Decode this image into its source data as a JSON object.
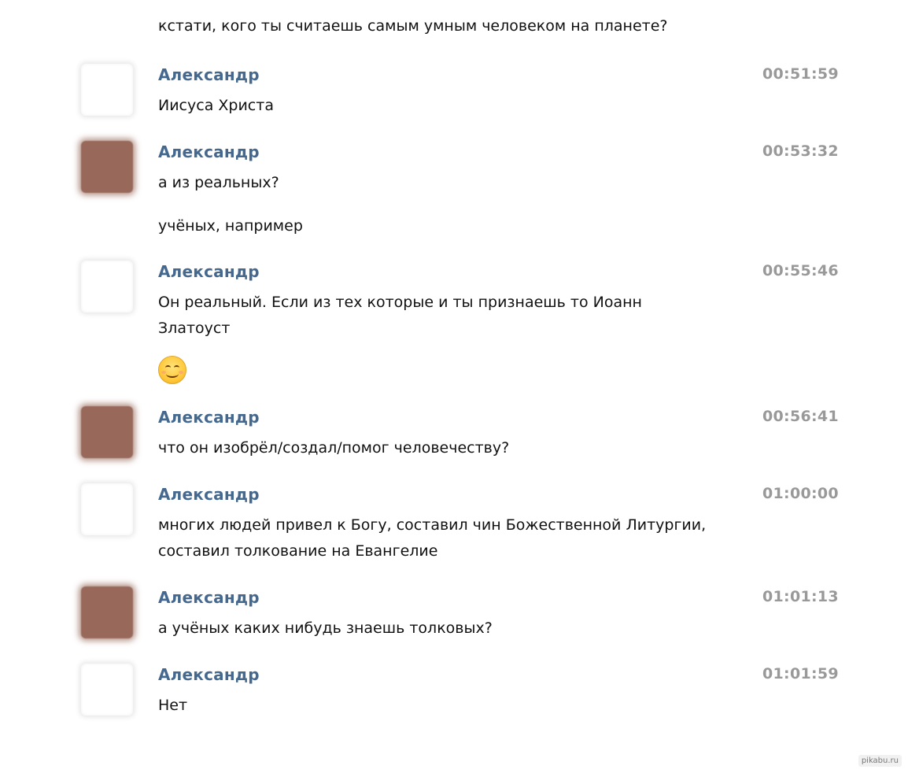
{
  "intro_text": "кстати, кого ты считаешь самым умным человеком на планете?",
  "messages": [
    {
      "author": "Александр",
      "time": "00:51:59",
      "lines": [
        "Иисуса Христа"
      ]
    },
    {
      "author": "Александр",
      "time": "00:53:32",
      "lines": [
        "а из реальных?",
        "учёных, например"
      ]
    },
    {
      "author": "Александр",
      "time": "00:55:46",
      "lines": [
        "Он реальный. Если из тех которые и ты признаешь то Иоанн",
        "Златоуст"
      ]
    },
    {
      "author": "Александр",
      "time": "00:56:41",
      "lines": [
        "что он изобрёл/создал/помог человечеству?"
      ]
    },
    {
      "author": "Александр",
      "time": "01:00:00",
      "lines": [
        "многих людей привел к Богу, составил чин Божественной Литургии,",
        "составил толкование на Евангелие"
      ]
    },
    {
      "author": "Александр",
      "time": "01:01:13",
      "lines": [
        "а учёных каких нибудь знаешь толковых?"
      ]
    },
    {
      "author": "Александр",
      "time": "01:01:59",
      "lines": [
        "Нет"
      ]
    }
  ],
  "emoji_icon": "smiling-face-emoji",
  "watermark": "pikabu.ru"
}
